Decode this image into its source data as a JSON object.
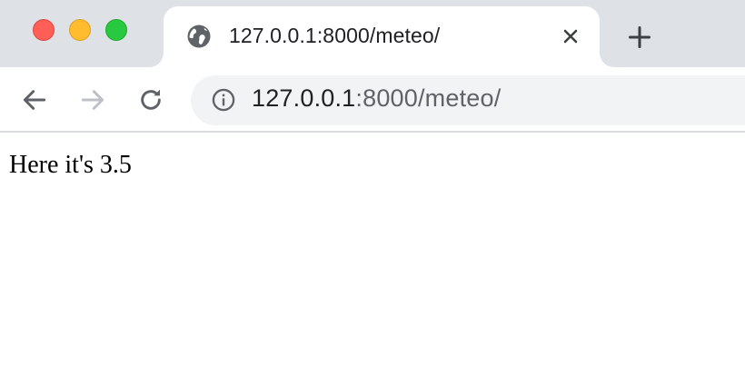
{
  "window": {
    "traffic_lights": {
      "close": "#ff5f57",
      "minimize": "#febc2e",
      "maximize": "#28c840"
    }
  },
  "tab": {
    "title": "127.0.0.1:8000/meteo/",
    "favicon": "globe-icon",
    "close_icon": "close-icon"
  },
  "new_tab_icon": "plus-icon",
  "toolbar": {
    "back_icon": "back-arrow-icon",
    "forward_icon": "forward-arrow-icon",
    "reload_icon": "reload-icon"
  },
  "address_bar": {
    "security_icon": "info-icon",
    "host": "127.0.0.1",
    "rest": ":8000/meteo/"
  },
  "page": {
    "text": "Here it's 3.5"
  }
}
